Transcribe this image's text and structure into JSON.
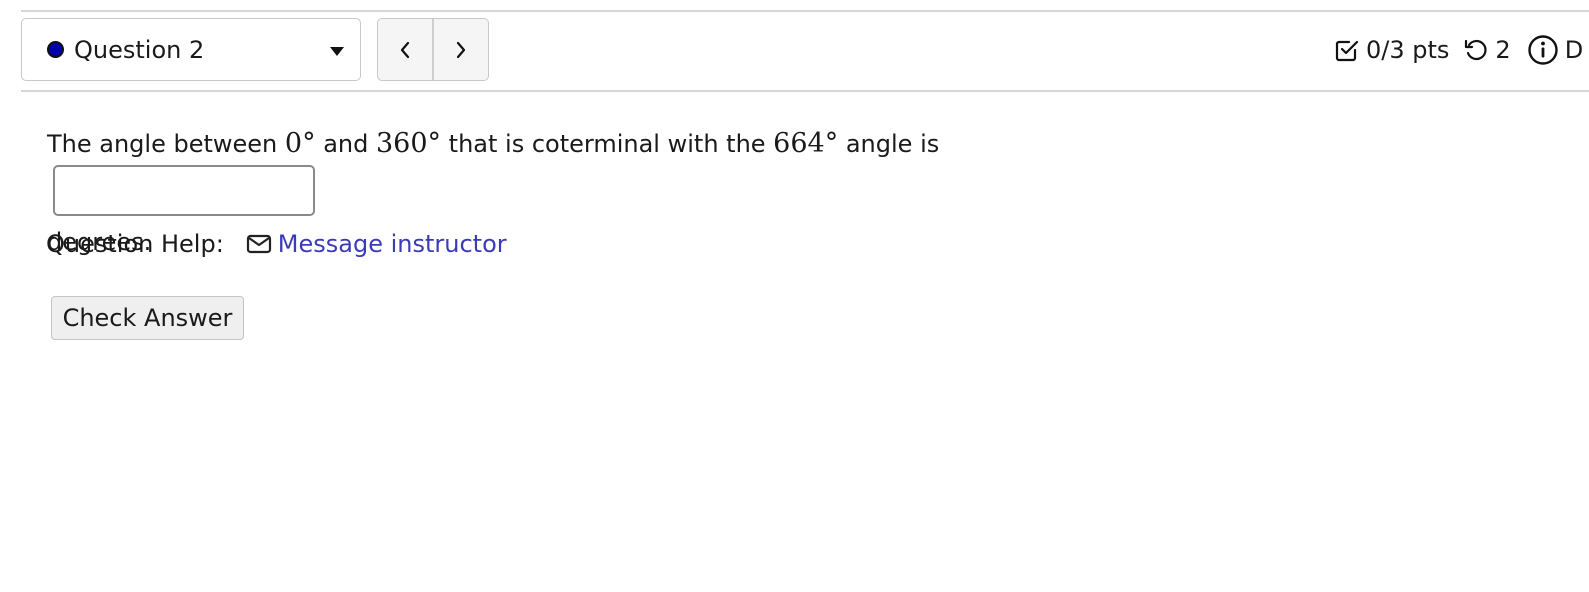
{
  "header": {
    "question_selector": {
      "label": "Question 2",
      "status_color": "#0000a8"
    },
    "nav": {
      "prev_label": "‹",
      "next_label": "›"
    },
    "status": {
      "points": "0/3 pts",
      "retries": "2",
      "cut_text": "D"
    }
  },
  "question": {
    "text_1": "The angle between ",
    "math_1": "0°",
    "text_2": " and ",
    "math_2": "360°",
    "text_3": " that is coterminal with the ",
    "math_3": "664°",
    "text_4": " angle is",
    "text_5": "degrees.",
    "answer_value": ""
  },
  "help": {
    "label": "Question Help:",
    "link": "Message instructor"
  },
  "actions": {
    "check_answer": "Check Answer"
  }
}
